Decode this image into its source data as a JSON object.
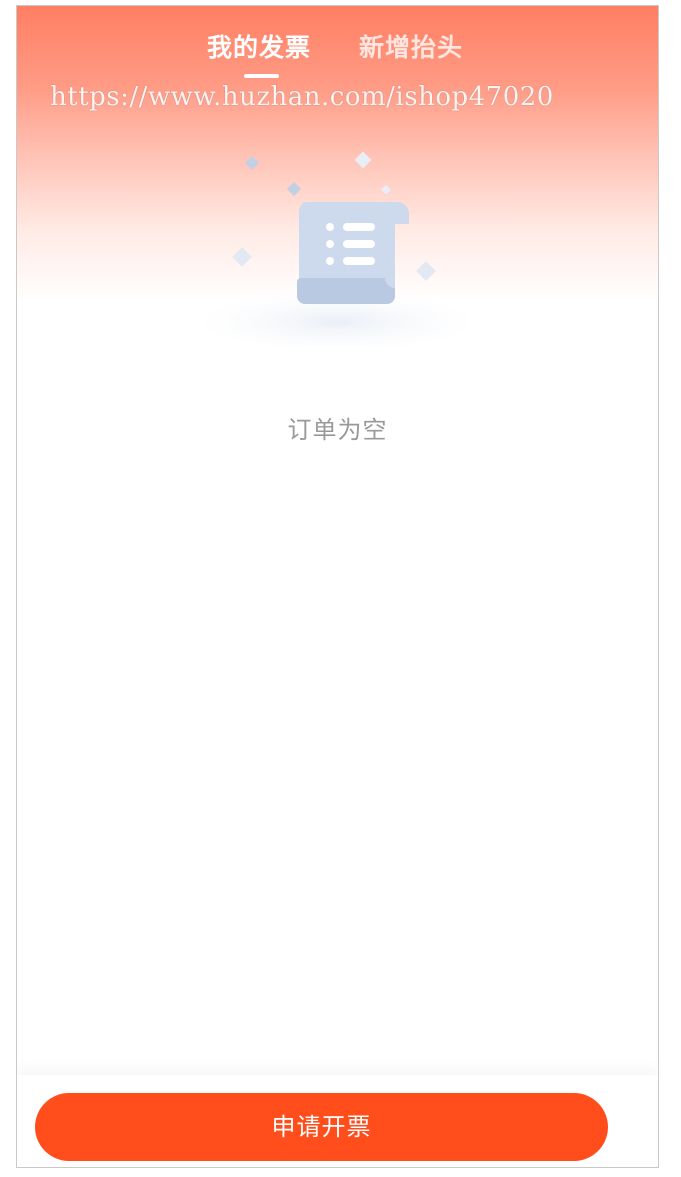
{
  "tabs": [
    {
      "label": "我的发票",
      "active": true
    },
    {
      "label": "新增抬头",
      "active": false
    }
  ],
  "watermark": "https://www.huzhan.com/ishop47020",
  "empty_state": {
    "message": "订单为空",
    "illustration": "empty-invoice-scroll-icon"
  },
  "actions": {
    "apply_invoice_label": "申请开票"
  },
  "colors": {
    "header_gradient_top": "#ff7f63",
    "primary_button": "#ff4e1c",
    "empty_text": "#999999",
    "illustration": "#c9d8ee"
  }
}
